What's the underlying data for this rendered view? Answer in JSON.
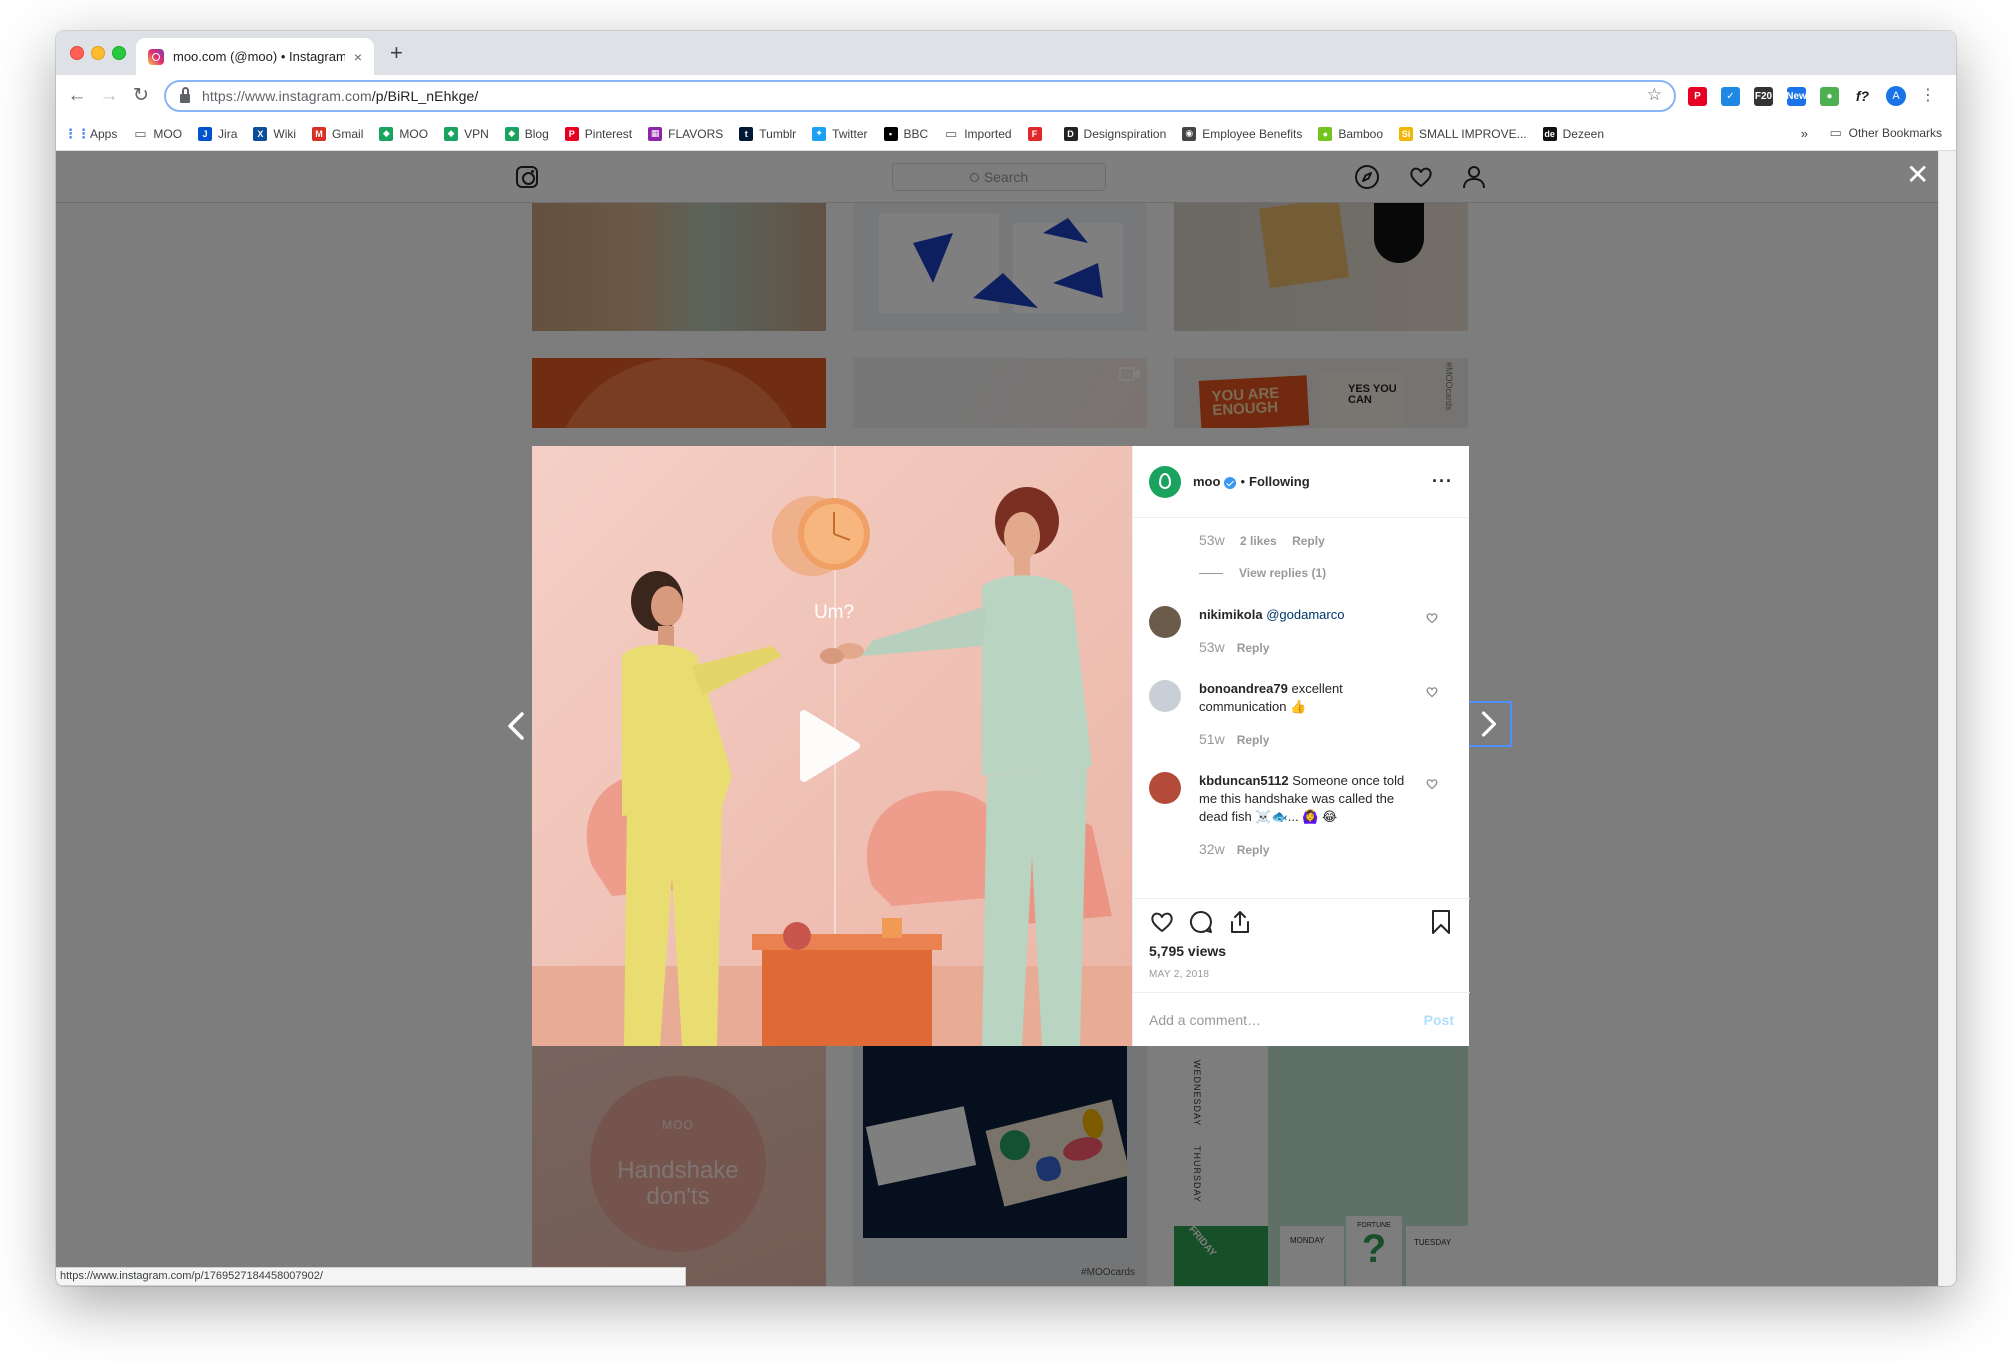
{
  "browser": {
    "tab_title": "moo.com (@moo) • Instagram",
    "tab_close": "×",
    "new_tab": "+",
    "url_host": "https://www.instagram.com",
    "url_path": "/p/BiRL_nEhkge/",
    "back": "←",
    "forward": "→",
    "reload": "↻",
    "star": "☆",
    "profile_initial": "A",
    "extensions": [
      {
        "name": "pinterest-extension-icon",
        "label": "P",
        "color": "#e60023"
      },
      {
        "name": "check-extension-icon",
        "label": "✓",
        "color": "#1e88e5"
      },
      {
        "name": "f20-extension-icon",
        "label": "F20",
        "color": "#333333"
      },
      {
        "name": "new-extension-icon",
        "label": "New",
        "color": "#1a73e8"
      },
      {
        "name": "chrome-extension-icon",
        "label": "●",
        "color": "#4caf50"
      },
      {
        "name": "whatfont-extension-icon",
        "label": "f?",
        "color": "#ffffff"
      }
    ],
    "menu_kebab": "⋮",
    "bookmarks": [
      {
        "name": "bookmark-apps",
        "label": "Apps",
        "icon": "⋮⋮",
        "color": "#4285f4"
      },
      {
        "name": "bookmark-moo-folder",
        "label": "MOO",
        "icon": "▭",
        "color": "#5f6368"
      },
      {
        "name": "bookmark-jira",
        "label": "Jira",
        "icon": "J",
        "color": "#0052cc"
      },
      {
        "name": "bookmark-wiki",
        "label": "Wiki",
        "icon": "X",
        "color": "#0b4f9c"
      },
      {
        "name": "bookmark-gmail",
        "label": "Gmail",
        "icon": "M",
        "color": "#d93025"
      },
      {
        "name": "bookmark-moo",
        "label": "MOO",
        "icon": "◆",
        "color": "#19a35e"
      },
      {
        "name": "bookmark-vpn",
        "label": "VPN",
        "icon": "◆",
        "color": "#19a35e"
      },
      {
        "name": "bookmark-blog",
        "label": "Blog",
        "icon": "◆",
        "color": "#19a35e"
      },
      {
        "name": "bookmark-pinterest",
        "label": "Pinterest",
        "icon": "P",
        "color": "#e60023"
      },
      {
        "name": "bookmark-flavors",
        "label": "FLAVORS",
        "icon": "▦",
        "color": "#8e24aa"
      },
      {
        "name": "bookmark-tumblr",
        "label": "Tumblr",
        "icon": "t",
        "color": "#001935"
      },
      {
        "name": "bookmark-twitter",
        "label": "Twitter",
        "icon": "✦",
        "color": "#1da1f2"
      },
      {
        "name": "bookmark-bbc",
        "label": "BBC",
        "icon": "▪",
        "color": "#000000"
      },
      {
        "name": "bookmark-imported",
        "label": "Imported",
        "icon": "▭",
        "color": "#5f6368"
      },
      {
        "name": "bookmark-flipboard",
        "label": "",
        "icon": "F",
        "color": "#e12828"
      },
      {
        "name": "bookmark-designspiration",
        "label": "Designspiration",
        "icon": "D",
        "color": "#222222"
      },
      {
        "name": "bookmark-employee-benefits",
        "label": "Employee Benefits",
        "icon": "◉",
        "color": "#444444"
      },
      {
        "name": "bookmark-bamboo",
        "label": "Bamboo",
        "icon": "●",
        "color": "#73c41d"
      },
      {
        "name": "bookmark-small-improvements",
        "label": "SMALL IMPROVE...",
        "icon": "Si",
        "color": "#f2b705"
      },
      {
        "name": "bookmark-dezeen",
        "label": "Dezeen",
        "icon": "de",
        "color": "#111111"
      }
    ],
    "bookmarks_overflow": "»",
    "other_bookmarks": "Other Bookmarks",
    "status_url": "https://www.instagram.com/p/1769527184458007902/"
  },
  "instagram": {
    "search_placeholder": "Search",
    "close": "✕",
    "post": {
      "username": "moo",
      "dot": "•",
      "following": "Following",
      "more": "···",
      "video_caption": "Um?",
      "thread": {
        "age": "53w",
        "likes": "2 likes",
        "reply": "Reply",
        "view_replies": "View replies (1)"
      },
      "comments": [
        {
          "user": "nikimikola",
          "text": "",
          "mention": "@godamarco",
          "age": "53w",
          "reply": "Reply",
          "avatar": "#6b5b4b"
        },
        {
          "user": "bonoandrea79",
          "text": " excellent communication 👍",
          "mention": "",
          "age": "51w",
          "reply": "Reply",
          "avatar": "#c9cfd6"
        },
        {
          "user": "kbduncan5112",
          "text": " Someone once told me this handshake was called the dead fish ☠️🐟... 🙆‍♀️ 😂",
          "mention": "",
          "age": "32w",
          "reply": "Reply",
          "avatar": "#b34a3a"
        }
      ],
      "views": "5,795 views",
      "date": "MAY 2, 2018",
      "add_comment": "Add a comment…",
      "post_button": "Post"
    },
    "tiles": {
      "you_are_enough": "YOU ARE ENOUGH",
      "yes_you_can": "YES YOU CAN",
      "moocards_top": "#MOOcards",
      "moo_logo": "MOO",
      "handshake": "Handshake don'ts",
      "moocards": "#MOOcards",
      "monday": "MONDAY",
      "tuesday": "TUESDAY",
      "friday": "FRIDAY",
      "fortune": "FORTUNE",
      "wednesday": "WEDNESDAY",
      "thursday": "THURSDAY",
      "question": "?"
    }
  }
}
